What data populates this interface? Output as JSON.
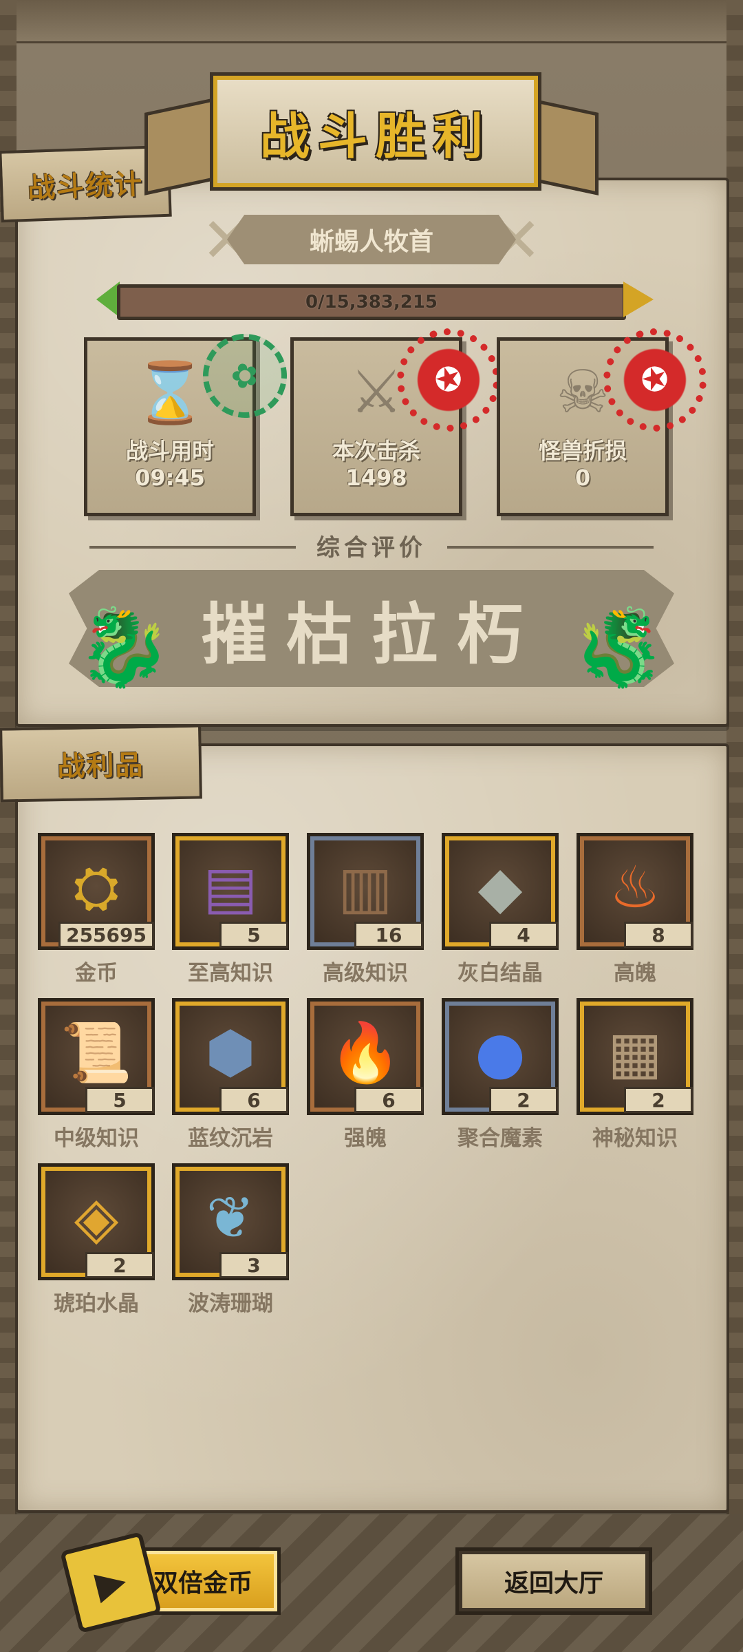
{
  "header": {
    "victory_title": "战斗胜利",
    "stats_tab": "战斗统计",
    "boss_name": "蜥蜴人牧首",
    "progress": {
      "text": "0/15,383,215",
      "current": 0,
      "total": 15383215
    }
  },
  "stats": [
    {
      "label": "战斗用时",
      "value": "09:45",
      "icon": "hourglass-icon",
      "stamp": "green-badge"
    },
    {
      "label": "本次击杀",
      "value": "1498",
      "icon": "crossed-swords-icon",
      "stamp": "red-badge"
    },
    {
      "label": "怪兽折损",
      "value": "0",
      "icon": "horned-skull-icon",
      "stamp": "red-badge"
    }
  ],
  "rating": {
    "heading": "综合评价",
    "value": "摧枯拉朽"
  },
  "loot": {
    "tab": "战利品",
    "items": [
      {
        "name": "金币",
        "count": "255695",
        "icon": "gold-coin-icon",
        "rarity": "bronze"
      },
      {
        "name": "至高知识",
        "count": "5",
        "icon": "treasure-book-icon",
        "rarity": "gold"
      },
      {
        "name": "高级知识",
        "count": "16",
        "icon": "bound-book-icon",
        "rarity": "steel"
      },
      {
        "name": "灰白结晶",
        "count": "4",
        "icon": "grey-crystal-icon",
        "rarity": "gold"
      },
      {
        "name": "高魄",
        "count": "8",
        "icon": "fire-soul-icon",
        "rarity": "bronze"
      },
      {
        "name": "中级知识",
        "count": "5",
        "icon": "scroll-icon",
        "rarity": "bronze"
      },
      {
        "name": "蓝纹沉岩",
        "count": "6",
        "icon": "blue-rock-icon",
        "rarity": "gold"
      },
      {
        "name": "强魄",
        "count": "6",
        "icon": "flame-icon",
        "rarity": "bronze"
      },
      {
        "name": "聚合魔素",
        "count": "2",
        "icon": "magic-orb-icon",
        "rarity": "steel"
      },
      {
        "name": "神秘知识",
        "count": "2",
        "icon": "stone-tablet-icon",
        "rarity": "gold"
      },
      {
        "name": "琥珀水晶",
        "count": "2",
        "icon": "amber-crystal-icon",
        "rarity": "gold"
      },
      {
        "name": "波涛珊瑚",
        "count": "3",
        "icon": "coral-icon",
        "rarity": "gold"
      }
    ]
  },
  "buttons": {
    "double_gold": "双倍金币",
    "return_hall": "返回大厅"
  },
  "colors": {
    "parchment": "#d8cdb6",
    "ink": "#3e3428",
    "gold": "#e0a92a",
    "stamp_red": "#d42a2a",
    "stamp_green": "#2e9a5a"
  }
}
